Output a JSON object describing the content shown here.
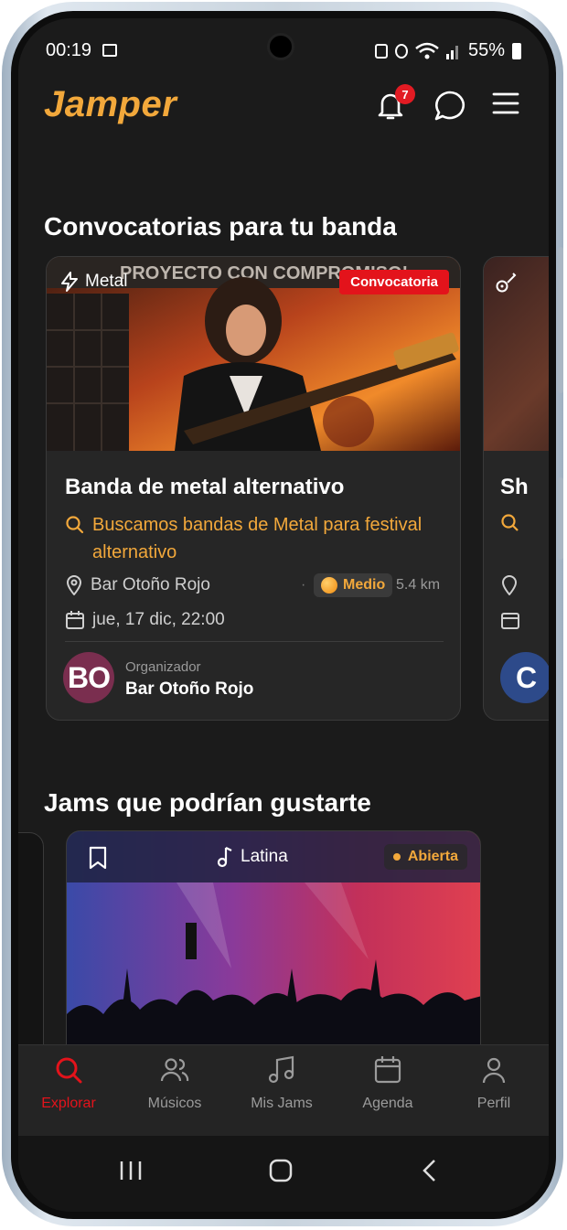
{
  "status": {
    "time": "00:19",
    "battery": "55%"
  },
  "header": {
    "logo": "Jamper",
    "notifications_count": "7"
  },
  "sections": {
    "convocatorias_title": "Convocatorias para tu banda",
    "jams_title": "Jams que podrían gustarte"
  },
  "convocatoria_card": {
    "genre": "Metal",
    "badge": "Convocatoria",
    "title": "Banda de metal alternativo",
    "subtitle": "Buscamos bandas de Metal para festival alternativo",
    "venue": "Bar Otoño Rojo",
    "level": "Medio",
    "distance": "5.4 km",
    "date": "jue, 17 dic, 22:00",
    "organizer_label": "Organizador",
    "organizer_name": "Bar Otoño Rojo",
    "organizer_initials": "BO",
    "poster_text": "PROYECTO CON COMPROMISO!"
  },
  "next_card": {
    "title_fragment": "Sh",
    "avatar_fragment": "C"
  },
  "jam_card": {
    "genre": "Latina",
    "status": "Abierta"
  },
  "nav": [
    {
      "label": "Explorar",
      "icon": "search-icon"
    },
    {
      "label": "Músicos",
      "icon": "users-icon"
    },
    {
      "label": "Mis Jams",
      "icon": "music-icon"
    },
    {
      "label": "Agenda",
      "icon": "calendar-icon"
    },
    {
      "label": "Perfil",
      "icon": "user-icon"
    }
  ],
  "colors": {
    "accent": "#f2a83b",
    "brand_red": "#e3131b",
    "background": "#1b1b1b",
    "card": "#262626"
  }
}
